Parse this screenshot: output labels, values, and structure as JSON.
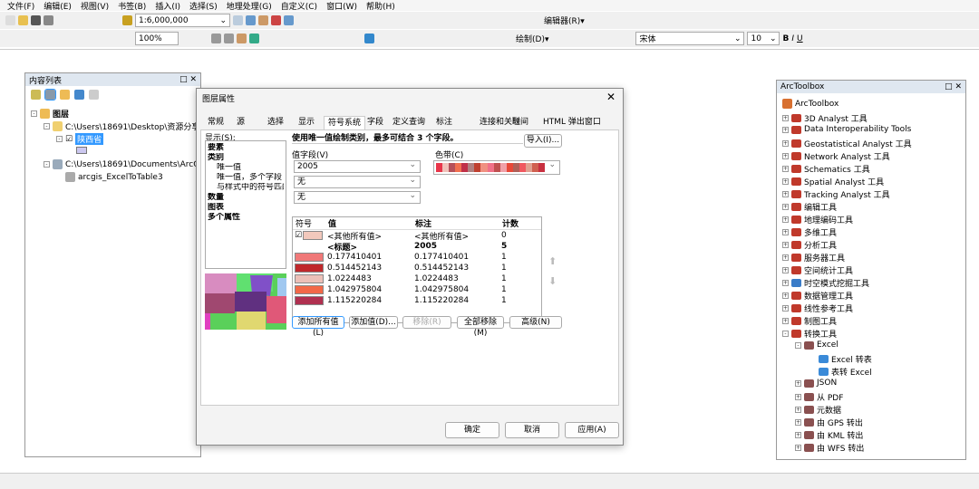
{
  "menu": [
    "文件(F)",
    "编辑(E)",
    "视图(V)",
    "书签(B)",
    "插入(I)",
    "选择(S)",
    "地理处理(G)",
    "自定义(C)",
    "窗口(W)",
    "帮助(H)"
  ],
  "toolbar": {
    "scale": "1:6,000,000",
    "editor": "编辑器(R)▾",
    "zoom": "100%",
    "draw": "绘制(D)▾",
    "font": "宋体",
    "font_size": "10"
  },
  "toc": {
    "title": "内容列表",
    "layers_label": "图层",
    "folder1": "C:\\Users\\18691\\Desktop\\资源分享\\",
    "layer": "陕西省",
    "folder2": "C:\\Users\\18691\\Documents\\ArcGIS",
    "table": "arcgis_ExcelToTable3"
  },
  "dialog": {
    "title": "图层属性",
    "tabs": [
      "常规",
      "源",
      "选择",
      "显示",
      "符号系统",
      "字段",
      "定义查询",
      "标注",
      "连接和关联",
      "时间",
      "HTML 弹出窗口"
    ],
    "show_label": "显示(S):",
    "tree": [
      "要素",
      "类别",
      "唯一值",
      "唯一值，多个字段",
      "与样式中的符号匹配",
      "数量",
      "图表",
      "多个属性"
    ],
    "heading": "使用唯一值绘制类别，最多可结合 3 个字段。",
    "import": "导入(I)...",
    "value_field_label": "值字段(V)",
    "fields": [
      "2005",
      "无",
      "无"
    ],
    "color_ramp_label": "色带(C)",
    "ramp_colors": [
      "#e8354a",
      "#f0c0b8",
      "#b5505a",
      "#f07050",
      "#c03048",
      "#b08080",
      "#c04030",
      "#f09080",
      "#f07088",
      "#c05050",
      "#f0a0a8",
      "#e84838",
      "#b06058",
      "#f05860",
      "#e0a090",
      "#d06050",
      "#c83040"
    ],
    "table_headers": [
      "符号",
      "值",
      "标注",
      "计数"
    ],
    "rows": [
      {
        "color": "#f2c8bc",
        "value": "<其他所有值>",
        "label": "<其他所有值>",
        "count": "0",
        "checked": true
      },
      {
        "color": "",
        "value": "<标题>",
        "label": "2005",
        "count": "5",
        "bold": true
      },
      {
        "color": "#f07878",
        "value": "0.177410401",
        "label": "0.177410401",
        "count": "1"
      },
      {
        "color": "#c0282c",
        "value": "0.514452143",
        "label": "0.514452143",
        "count": "1"
      },
      {
        "color": "#ecc0b8",
        "value": "1.0224483",
        "label": "1.0224483",
        "count": "1"
      },
      {
        "color": "#f26848",
        "value": "1.042975804",
        "label": "1.042975804",
        "count": "1"
      },
      {
        "color": "#b03050",
        "value": "1.115220284",
        "label": "1.115220284",
        "count": "1"
      }
    ],
    "buttons": {
      "add_all": "添加所有值(L)",
      "add": "添加值(D)...",
      "remove": "移除(R)",
      "remove_all": "全部移除(M)",
      "advanced": "高级(N)",
      "ok": "确定",
      "cancel": "取消",
      "apply": "应用(A)"
    }
  },
  "toolbox": {
    "title": "ArcToolbox",
    "root": "ArcToolbox",
    "items": [
      "3D Analyst 工具",
      "Data Interoperability Tools",
      "Geostatistical Analyst 工具",
      "Network Analyst 工具",
      "Schematics 工具",
      "Spatial Analyst 工具",
      "Tracking Analyst 工具",
      "编辑工具",
      "地理编码工具",
      "多维工具",
      "分析工具",
      "服务器工具",
      "空间统计工具",
      "时空模式挖掘工具",
      "数据管理工具",
      "线性参考工具",
      "制图工具",
      "转换工具"
    ],
    "excel": "Excel",
    "excel_tools": [
      "Excel 转表",
      "表转 Excel"
    ],
    "sub": [
      "JSON",
      "从 PDF",
      "元数据",
      "由 GPS 转出",
      "由 KML 转出",
      "由 WFS 转出"
    ]
  }
}
